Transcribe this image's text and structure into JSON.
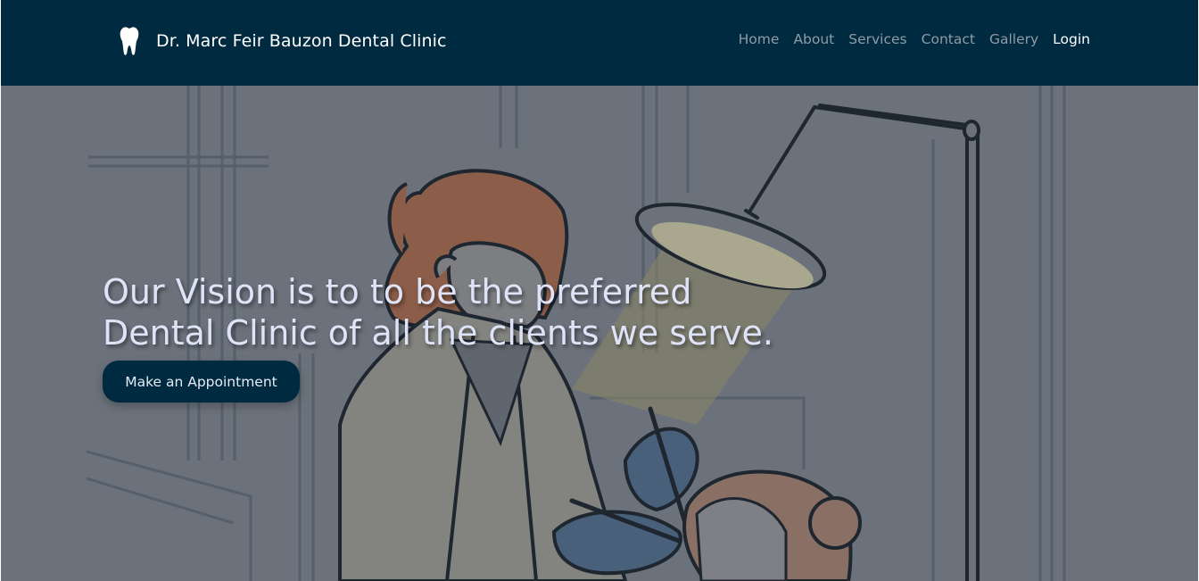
{
  "brand": {
    "name": "Dr. Marc Feir Bauzon Dental Clinic",
    "logo_icon": "tooth-icon"
  },
  "nav": {
    "items": [
      {
        "label": "Home"
      },
      {
        "label": "About"
      },
      {
        "label": "Services"
      },
      {
        "label": "Contact"
      },
      {
        "label": "Gallery"
      },
      {
        "label": "Login",
        "active": true
      }
    ]
  },
  "hero": {
    "headline_line1": "Our Vision is to to be the preferred",
    "headline_line2": "Dental Clinic of all the clients we serve.",
    "cta_label": "Make an Appointment",
    "illustration": "dentist-treating-patient-illustration"
  },
  "colors": {
    "navbar_bg": "#002a40",
    "hero_overlay": "#6b727b",
    "headline_text": "#dfe3f8",
    "button_bg": "#002a40"
  }
}
